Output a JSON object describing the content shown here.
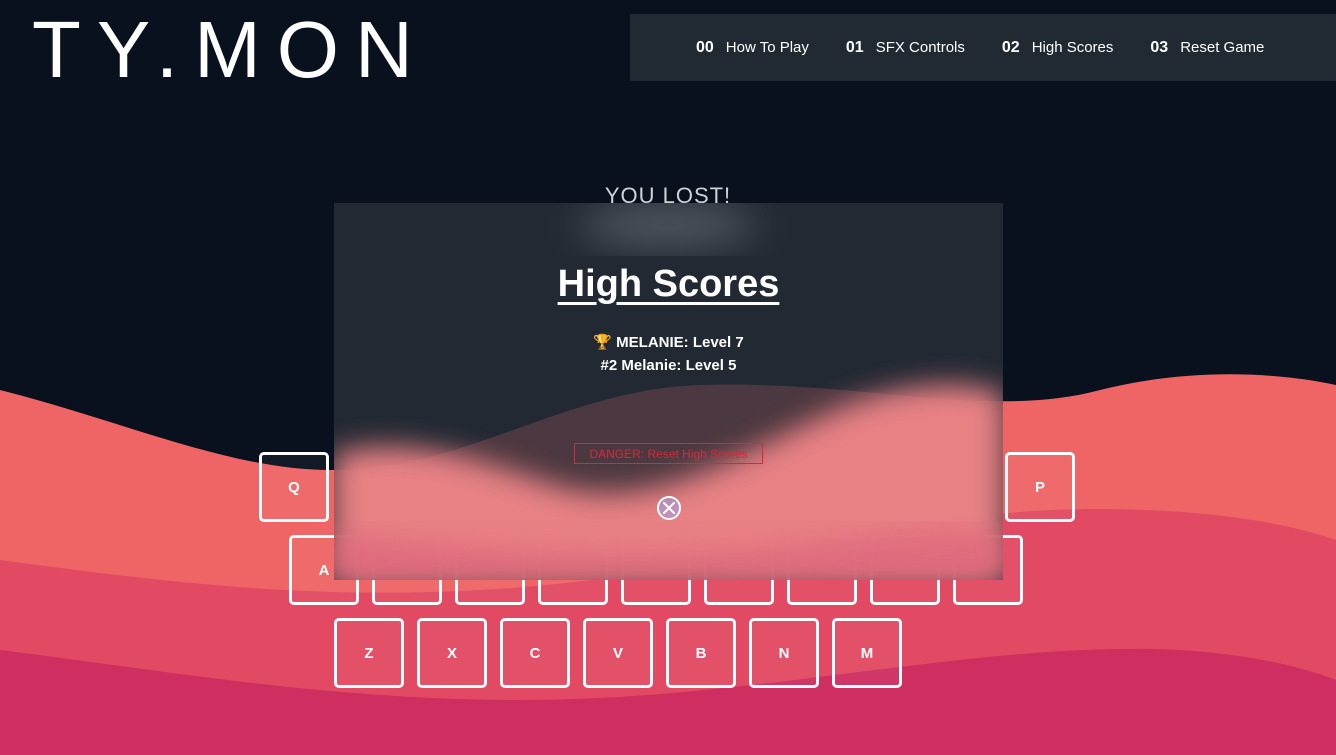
{
  "app": {
    "logo": "TY.MON"
  },
  "nav": {
    "items": [
      {
        "num": "00",
        "label": "How To Play"
      },
      {
        "num": "01",
        "label": "SFX Controls"
      },
      {
        "num": "02",
        "label": "High Scores"
      },
      {
        "num": "03",
        "label": "Reset Game"
      }
    ]
  },
  "game": {
    "status": "YOU LOST!"
  },
  "keyboard": {
    "row1": [
      "Q",
      "P"
    ],
    "row2": [
      "A"
    ],
    "row3": [
      "Z",
      "X",
      "C",
      "V",
      "B",
      "N",
      "M"
    ]
  },
  "modal": {
    "title": "High Scores",
    "scores": [
      {
        "rank_icon": "trophy-icon",
        "text": "🏆 MELANIE: Level 7"
      },
      {
        "text": "#2 Melanie: Level 5"
      }
    ],
    "danger_label": "DANGER: Reset High Scores",
    "close_icon": "close-circle-icon"
  },
  "colors": {
    "background": "#08111d",
    "nav_bg": "#212933",
    "wave_light": "#ef6565",
    "wave_mid": "#e04a63",
    "wave_dark": "#c92560",
    "danger": "#d42a3c"
  }
}
